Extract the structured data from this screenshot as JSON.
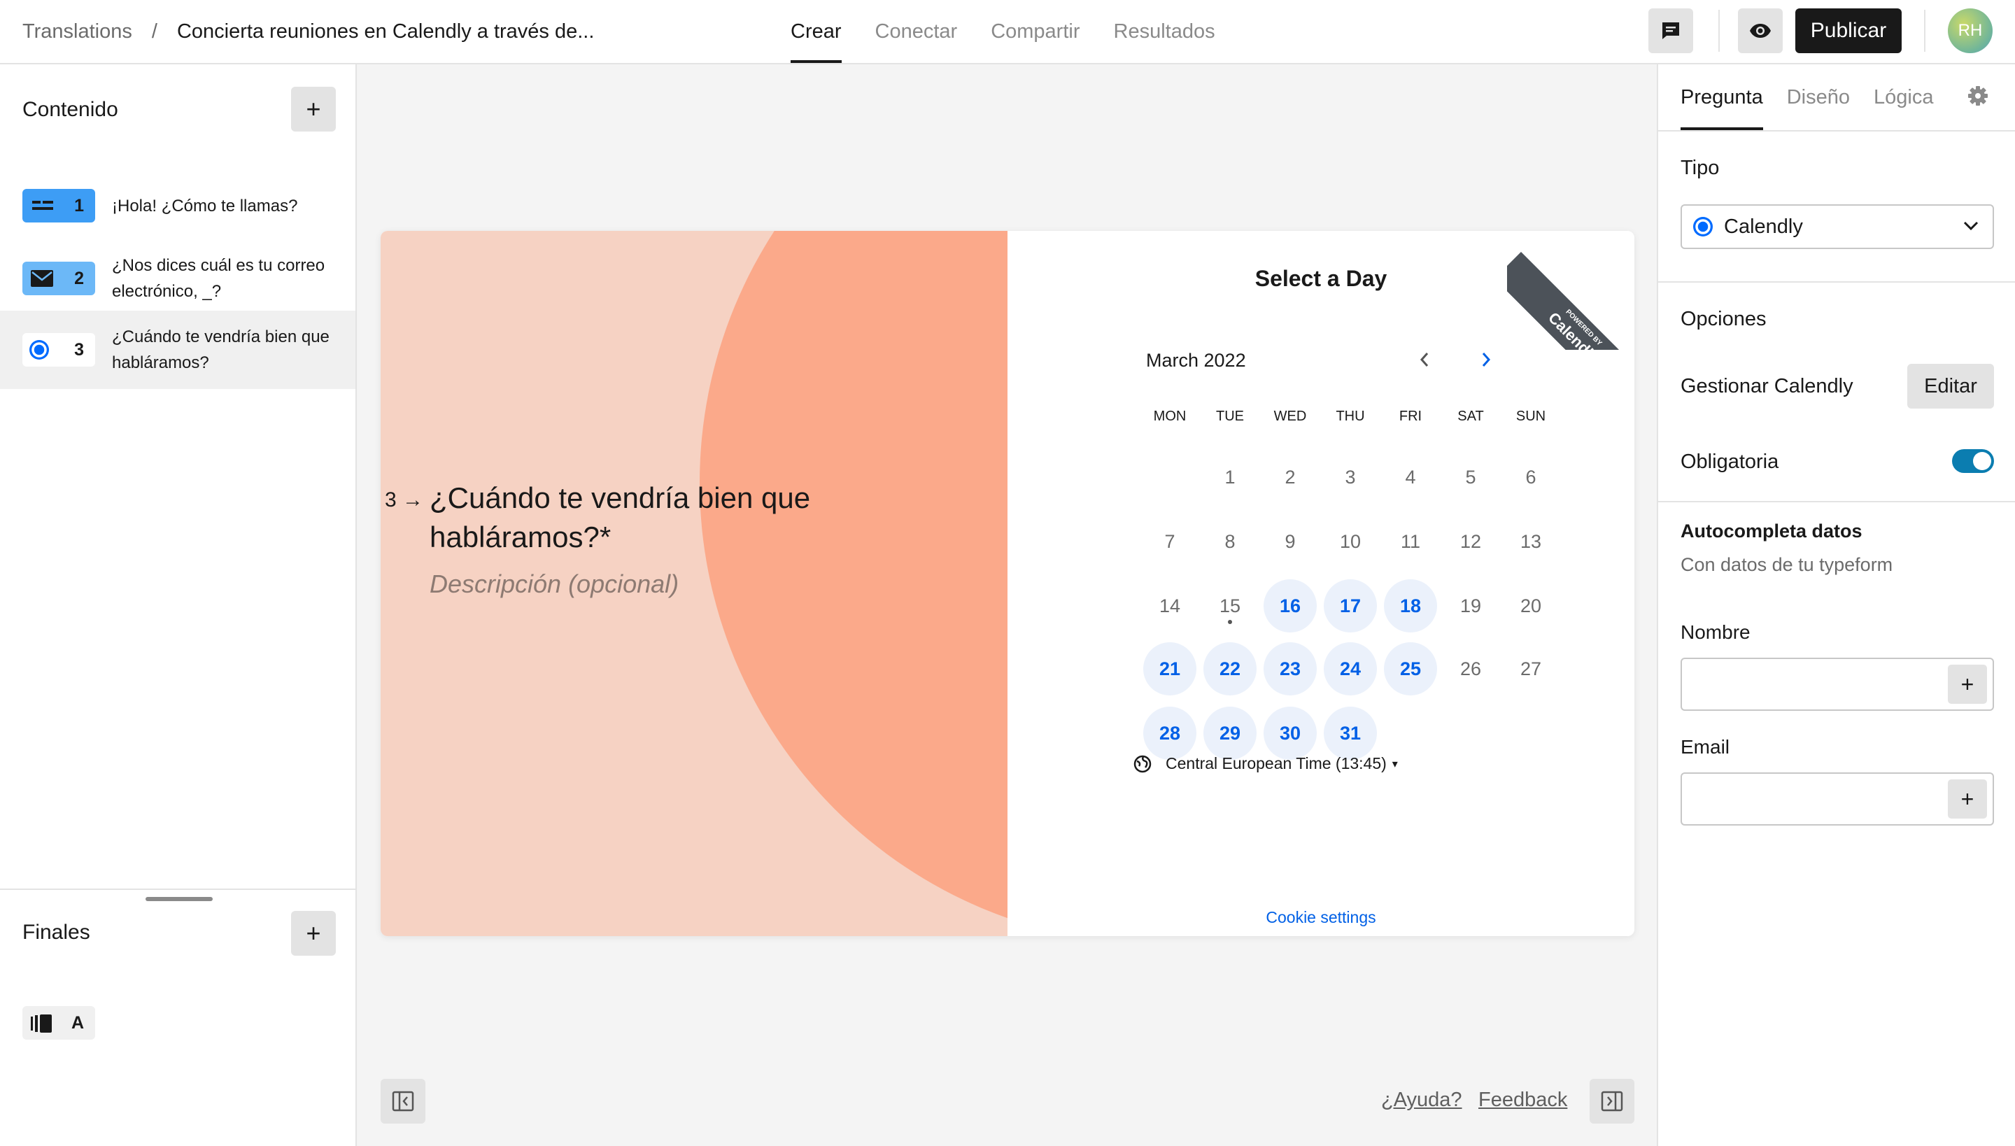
{
  "topbar": {
    "breadcrumb_root": "Translations",
    "breadcrumb_sep": "/",
    "form_title": "Concierta reuniones en Calendly a través de...",
    "tabs": [
      "Crear",
      "Conectar",
      "Compartir",
      "Resultados"
    ],
    "active_tab": "Crear",
    "publish_label": "Publicar",
    "avatar_initials": "RH"
  },
  "sidebar": {
    "content_title": "Contenido",
    "add_label": "+",
    "questions": [
      {
        "num": "1",
        "text": "¡Hola! ¿Cómo te llamas?",
        "icon": "short-text-icon",
        "color": "#3d9df5"
      },
      {
        "num": "2",
        "text": "¿Nos dices cuál es tu correo electrónico, _?",
        "icon": "email-icon",
        "color": "#6cb8f7"
      },
      {
        "num": "3",
        "text": "¿Cuándo te vendría bien que habláramos?",
        "icon": "calendly-icon",
        "color": "#ffffff"
      }
    ],
    "endings_title": "Finales",
    "endings": [
      {
        "num": "A",
        "icon": "ending-icon"
      }
    ]
  },
  "canvas": {
    "question_number": "3",
    "question_title": "¿Cuándo te vendría bien que habláramos?*",
    "description_placeholder": "Descripción (opcional)",
    "calendly": {
      "ribbon_small": "POWERED BY",
      "ribbon_brand": "Calendly",
      "title": "Select a Day",
      "month": "March 2022",
      "weekdays": [
        "MON",
        "TUE",
        "WED",
        "THU",
        "FRI",
        "SAT",
        "SUN"
      ],
      "days": [
        [
          "",
          "1",
          "2",
          "3",
          "4",
          "5",
          "6"
        ],
        [
          "7",
          "8",
          "9",
          "10",
          "11",
          "12",
          "13"
        ],
        [
          "14",
          "15",
          "16",
          "17",
          "18",
          "19",
          "20"
        ],
        [
          "21",
          "22",
          "23",
          "24",
          "25",
          "26",
          "27"
        ],
        [
          "28",
          "29",
          "30",
          "31",
          "",
          "",
          ""
        ]
      ],
      "available_days": [
        "16",
        "17",
        "18",
        "21",
        "22",
        "23",
        "24",
        "25",
        "28",
        "29",
        "30",
        "31"
      ],
      "today": "15",
      "timezone": "Central European Time (13:45)",
      "cookie_label": "Cookie settings"
    },
    "colors": {
      "left_bg": "#f6d2c3",
      "circle": "#fba98a",
      "available": "#0060e6"
    }
  },
  "footer": {
    "help_label": "¿Ayuda?",
    "feedback_label": "Feedback"
  },
  "panel": {
    "tabs": [
      "Pregunta",
      "Diseño",
      "Lógica"
    ],
    "active_tab": "Pregunta",
    "type_label": "Tipo",
    "type_value": "Calendly",
    "options_label": "Opciones",
    "manage_label": "Gestionar Calendly",
    "edit_label": "Editar",
    "required_label": "Obligatoria",
    "required_on": true,
    "autocomplete_title": "Autocompleta datos",
    "autocomplete_sub": "Con datos de tu typeform",
    "name_label": "Nombre",
    "email_label": "Email"
  }
}
